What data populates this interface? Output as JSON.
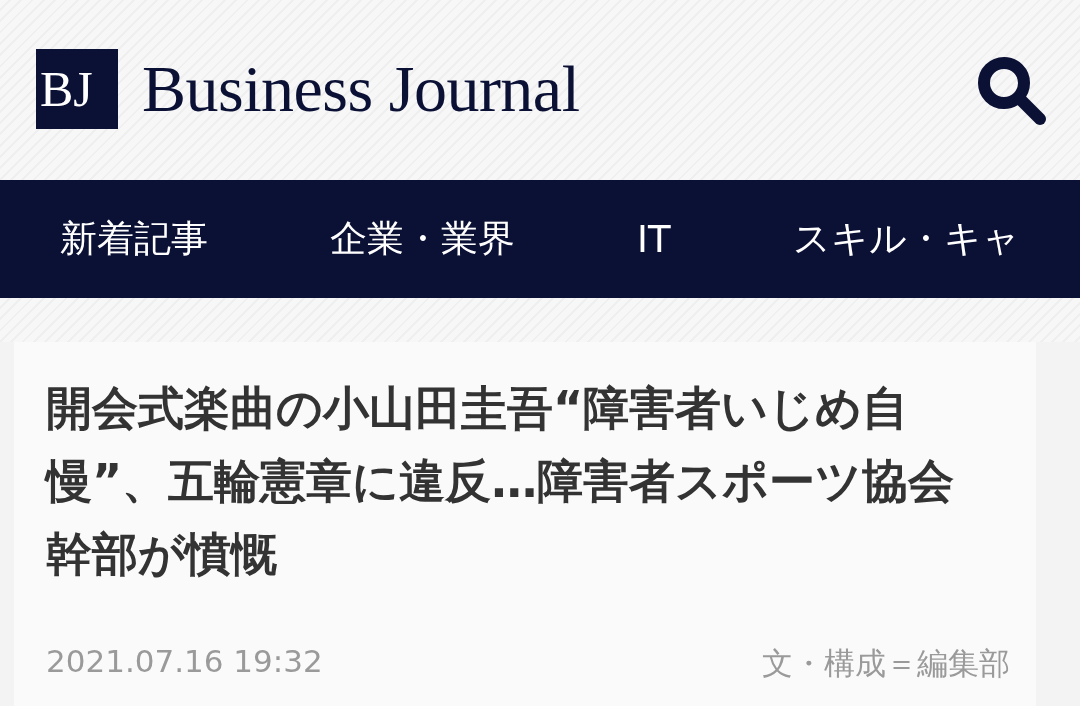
{
  "header": {
    "logo_mark": "BJ",
    "logo_text": "Business Journal"
  },
  "nav": {
    "items": [
      {
        "label": "新着記事",
        "selected": false
      },
      {
        "label": "企業・業界",
        "selected": false
      },
      {
        "label": "IT",
        "selected": false
      },
      {
        "label": "スキル・キャ",
        "selected": false
      }
    ]
  },
  "article": {
    "title": "開会式楽曲の小山田圭吾“障害者いじめ自慢”、五輪憲章に違反…障害者スポーツ協会幹部が憤慨",
    "date": "2021.07.16 19:32",
    "byline": "文・構成＝編集部"
  }
}
